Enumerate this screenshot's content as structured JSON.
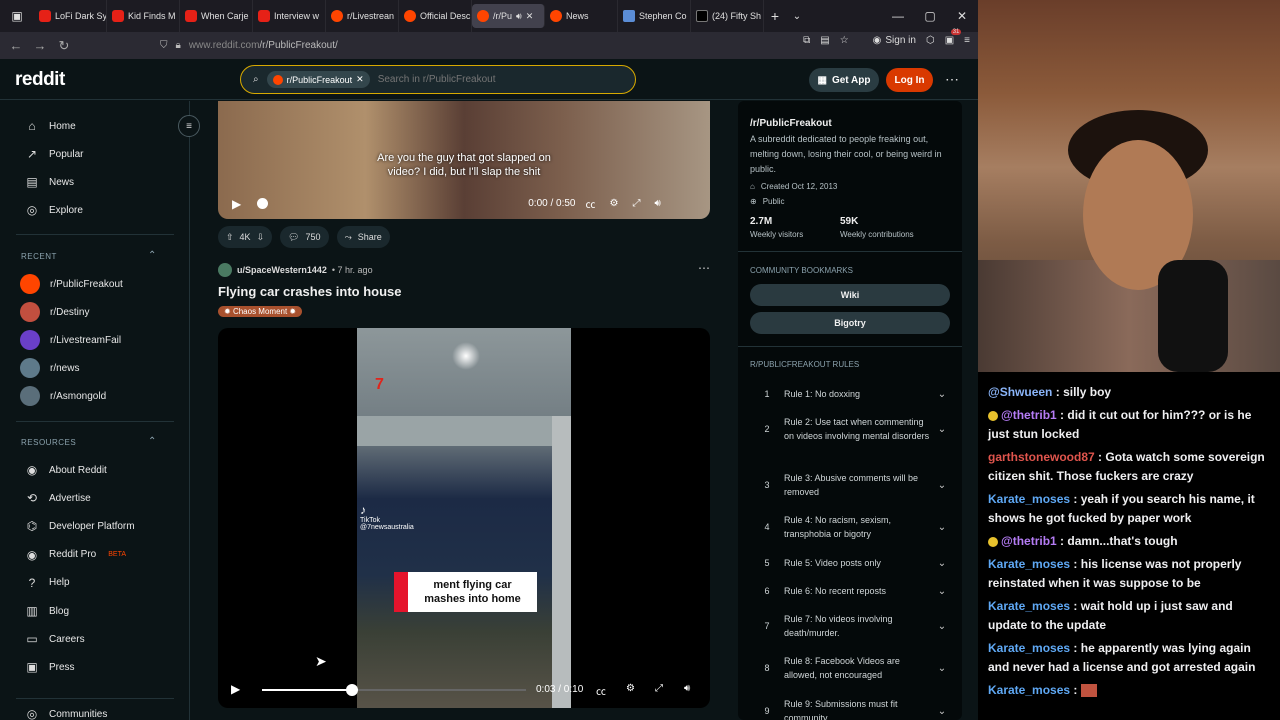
{
  "browser": {
    "tabs": [
      {
        "label": "LoFi Dark Sy",
        "icon": "youtube-icon"
      },
      {
        "label": "Kid Finds M",
        "icon": "youtube-icon"
      },
      {
        "label": "When Carje",
        "icon": "youtube-icon"
      },
      {
        "label": "Interview w",
        "icon": "youtube-icon"
      },
      {
        "label": "r/Livestrean",
        "icon": "reddit-icon"
      },
      {
        "label": "Official Desc",
        "icon": "reddit-icon"
      },
      {
        "label": "/r/Pu",
        "icon": "reddit-icon"
      },
      {
        "label": "News",
        "icon": "reddit-icon"
      },
      {
        "label": "Stephen Co",
        "icon": "scholar-icon"
      },
      {
        "label": "(24) Fifty Sh",
        "icon": "x-icon"
      }
    ],
    "url_host": "www.reddit.com",
    "url_path": "/r/PublicFreakout/",
    "sign_in": "Sign in",
    "ext_badge": "31"
  },
  "header": {
    "logo": "reddit",
    "search_chip": "r/PublicFreakout",
    "search_placeholder": "Search in r/PublicFreakout",
    "get_app": "Get App",
    "login": "Log In"
  },
  "sidebar": {
    "main": [
      "Home",
      "Popular",
      "News",
      "Explore"
    ],
    "recent_heading": "RECENT",
    "recent": [
      "r/PublicFreakout",
      "r/Destiny",
      "r/LivestreamFail",
      "r/news",
      "r/Asmongold"
    ],
    "resources_heading": "RESOURCES",
    "resources": [
      "About Reddit",
      "Advertise",
      "Developer Platform",
      "Reddit Pro",
      "Help",
      "Blog",
      "Careers",
      "Press"
    ],
    "beta": "BETA",
    "communities": "Communities"
  },
  "post1": {
    "caption_line1": "Are you the guy that got slapped on",
    "caption_line2": "video? I did, but I'll slap the shit",
    "time": "0:00 / 0:50",
    "votes": "4K",
    "comments": "750",
    "share": "Share"
  },
  "post2": {
    "user": "u/SpaceWestern1442",
    "age": "• 7 hr. ago",
    "title": "Flying car crashes into house",
    "flair": "Chaos Moment",
    "news_logo": "7",
    "tiktok": "TikTok",
    "tiktok_handle": "@7newsaustralia",
    "banner_line1": "ment flying car",
    "banner_line2": "mashes into home",
    "time": "0:03 / 0:10",
    "progress": 0.34
  },
  "community": {
    "name": "/r/PublicFreakout",
    "description": "A subreddit dedicated to people freaking out, melting down, losing their cool, or being weird in public.",
    "created": "Created Oct 12, 2013",
    "visibility": "Public",
    "visitors": "2.7M",
    "visitors_label": "Weekly visitors",
    "contributions": "59K",
    "contributions_label": "Weekly contributions",
    "bookmarks_heading": "COMMUNITY BOOKMARKS",
    "bookmarks": [
      "Wiki",
      "Bigotry"
    ],
    "rules_heading": "R/PUBLICFREAKOUT RULES",
    "rules": [
      "Rule 1: No doxxing",
      "Rule 2: Use tact when commenting on videos involving mental disorders",
      "Rule 3: Abusive comments will be removed",
      "Rule 4: No racism, sexism, transphobia or bigotry",
      "Rule 5: Video posts only",
      "Rule 6: No recent reposts",
      "Rule 7: No videos involving death/murder.",
      "Rule 8: Facebook Videos are allowed, not encouraged",
      "Rule 9: Submissions must fit community"
    ]
  },
  "chat": [
    {
      "user": "@Shwueen",
      "color": "#8ab4f8",
      "badge": false,
      "text": "silly boy"
    },
    {
      "user": "@thetrib1",
      "color": "#b57cf5",
      "badge": true,
      "text": "did it cut out for him??? or is he just stun locked"
    },
    {
      "user": "garthstonewood87",
      "color": "#e0554d",
      "badge": false,
      "text": "Gota watch some sovereign citizen shit. Those fuckers are crazy"
    },
    {
      "user": "Karate_moses",
      "color": "#5fa8f4",
      "badge": false,
      "text": "yeah if you search his name, it shows he got fucked by paper work"
    },
    {
      "user": "@thetrib1",
      "color": "#b57cf5",
      "badge": true,
      "text": "damn...that's tough"
    },
    {
      "user": "Karate_moses",
      "color": "#5fa8f4",
      "badge": false,
      "text": "his license was not properly reinstated when it was suppose to be"
    },
    {
      "user": "Karate_moses",
      "color": "#5fa8f4",
      "badge": false,
      "text": "wait hold up i just saw and update to the update"
    },
    {
      "user": "Karate_moses",
      "color": "#5fa8f4",
      "badge": false,
      "text": "he apparently was lying again and never had a license and got arrested again"
    },
    {
      "user": "Karate_moses",
      "color": "#5fa8f4",
      "badge": false,
      "text": "",
      "emote": true
    }
  ]
}
